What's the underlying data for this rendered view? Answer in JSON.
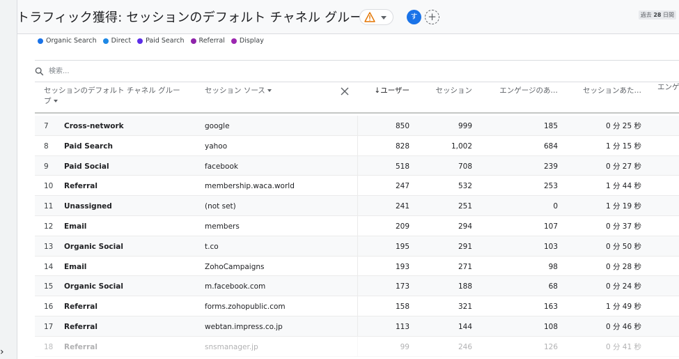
{
  "header": {
    "title": "トラフィック獲得: セッションのデフォルト チャネル グループ",
    "avatar_initial": "す",
    "add_symbol": "+",
    "date_range_prefix": "過去",
    "date_range_days": "28",
    "date_range_suffix": "日間"
  },
  "legend": [
    {
      "label": "Organic Search",
      "color": "#1a73e8"
    },
    {
      "label": "Direct",
      "color": "#1e88e5"
    },
    {
      "label": "Paid Search",
      "color": "#5c2ee8"
    },
    {
      "label": "Referral",
      "color": "#8e24aa"
    },
    {
      "label": "Display",
      "color": "#9c27b0"
    }
  ],
  "search": {
    "placeholder": "検索..."
  },
  "table": {
    "columns": {
      "dim1": "セッションのデフォルト チャネル グループ",
      "dim2": "セッション ソース",
      "users": "↓ユーザー",
      "sessions": "セッション",
      "engaged": "エンゲージのあ…",
      "avg_time": "セッションあた…",
      "extra": "エンゲ ユー"
    },
    "rows": [
      {
        "idx": "7",
        "channel": "Cross-network",
        "source": "google",
        "users": "850",
        "sessions": "999",
        "engaged": "185",
        "avg": "0 分 25 秒"
      },
      {
        "idx": "8",
        "channel": "Paid Search",
        "source": "yahoo",
        "users": "828",
        "sessions": "1,002",
        "engaged": "684",
        "avg": "1 分 15 秒"
      },
      {
        "idx": "9",
        "channel": "Paid Social",
        "source": "facebook",
        "users": "518",
        "sessions": "708",
        "engaged": "239",
        "avg": "0 分 27 秒"
      },
      {
        "idx": "10",
        "channel": "Referral",
        "source": "membership.waca.world",
        "users": "247",
        "sessions": "532",
        "engaged": "253",
        "avg": "1 分 44 秒"
      },
      {
        "idx": "11",
        "channel": "Unassigned",
        "source": "(not set)",
        "users": "241",
        "sessions": "251",
        "engaged": "0",
        "avg": "1 分 19 秒"
      },
      {
        "idx": "12",
        "channel": "Email",
        "source": "members",
        "users": "209",
        "sessions": "294",
        "engaged": "107",
        "avg": "0 分 37 秒"
      },
      {
        "idx": "13",
        "channel": "Organic Social",
        "source": "t.co",
        "users": "195",
        "sessions": "291",
        "engaged": "103",
        "avg": "0 分 50 秒"
      },
      {
        "idx": "14",
        "channel": "Email",
        "source": "ZohoCampaigns",
        "users": "193",
        "sessions": "271",
        "engaged": "98",
        "avg": "0 分 28 秒"
      },
      {
        "idx": "15",
        "channel": "Organic Social",
        "source": "m.facebook.com",
        "users": "173",
        "sessions": "188",
        "engaged": "68",
        "avg": "0 分 24 秒"
      },
      {
        "idx": "16",
        "channel": "Referral",
        "source": "forms.zohopublic.com",
        "users": "158",
        "sessions": "321",
        "engaged": "163",
        "avg": "1 分 49 秒"
      },
      {
        "idx": "17",
        "channel": "Referral",
        "source": "webtan.impress.co.jp",
        "users": "113",
        "sessions": "144",
        "engaged": "108",
        "avg": "0 分 46 秒"
      },
      {
        "idx": "18",
        "channel": "Referral",
        "source": "snsmanager.jp",
        "users": "99",
        "sessions": "246",
        "engaged": "126",
        "avg": "0 分 41 秒"
      }
    ]
  }
}
